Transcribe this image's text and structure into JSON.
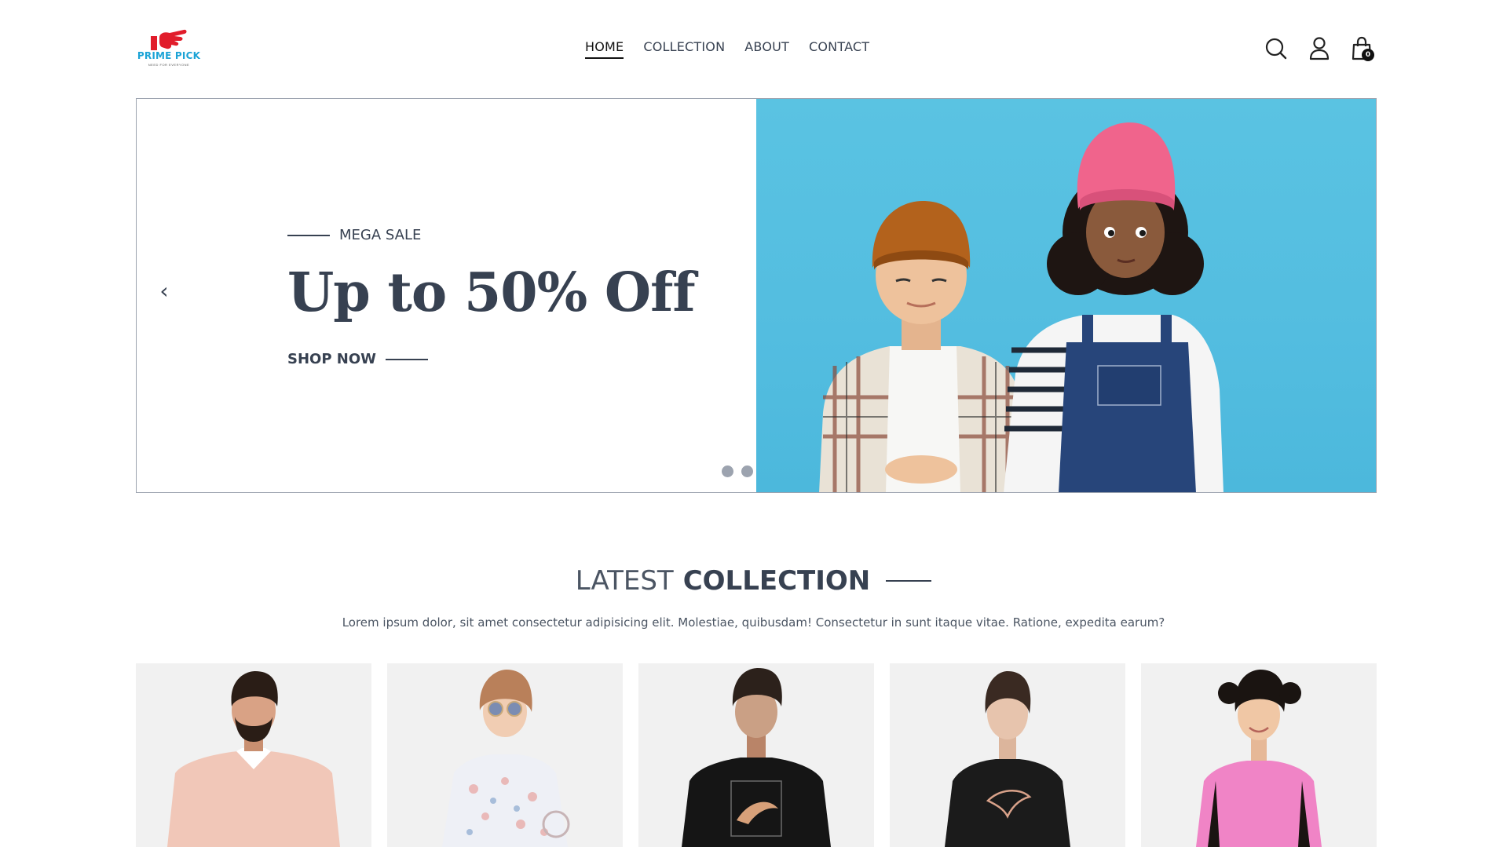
{
  "brand": {
    "name": "PRIME PICK",
    "tagline": "NEED FOR EVERYONE",
    "name_color": "#1ba3d6",
    "mark_color": "#e11d2b"
  },
  "nav": {
    "links": [
      {
        "label": "HOME",
        "active": true
      },
      {
        "label": "COLLECTION",
        "active": false
      },
      {
        "label": "ABOUT",
        "active": false
      },
      {
        "label": "CONTACT",
        "active": false
      }
    ]
  },
  "header_icons": {
    "search": "search-icon",
    "account": "user-icon",
    "cart": "cart-icon",
    "cart_count": "0"
  },
  "hero": {
    "eyebrow": "MEGA SALE",
    "headline": "Up to 50% Off",
    "cta": "SHOP NOW",
    "prev_arrow": "‹",
    "next_arrow": "›",
    "slides_total": 3,
    "active_slide": 3,
    "image_background": "#53bde0"
  },
  "latest_collection": {
    "title_light": "LATEST",
    "title_bold": "COLLECTION",
    "description": "Lorem ipsum dolor, sit amet consectetur adipisicing elit. Molestiae, quibusdam! Consectetur in sunt itaque vitae. Ratione, expedita earum?",
    "products": [
      {
        "subject": "man-in-pink-polo",
        "shirt_color": "#f1c7b8"
      },
      {
        "subject": "girl-in-floral-dress",
        "shirt_color": "#eef0f6"
      },
      {
        "subject": "man-in-black-tee",
        "shirt_color": "#151515"
      },
      {
        "subject": "woman-in-black-tee",
        "shirt_color": "#1b1b1b"
      },
      {
        "subject": "girl-in-pink-tee",
        "shirt_color": "#f084c6"
      }
    ]
  }
}
